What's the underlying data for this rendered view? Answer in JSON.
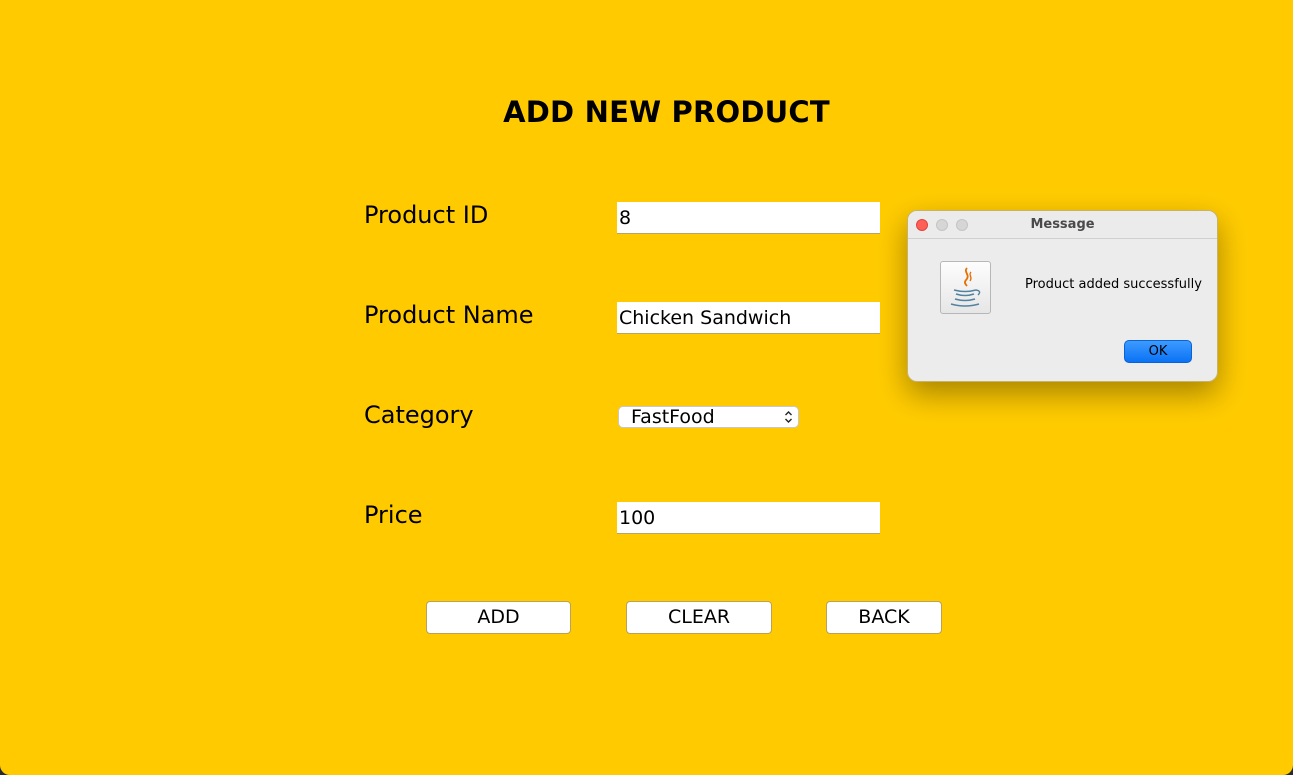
{
  "page": {
    "title": "ADD NEW PRODUCT",
    "background_color": "#ffcb00"
  },
  "form": {
    "product_id_label": "Product ID",
    "product_id_value": "8",
    "product_name_label": "Product Name",
    "product_name_value": "Chicken Sandwich",
    "category_label": "Category",
    "category_value": "FastFood",
    "price_label": "Price",
    "price_value": "100"
  },
  "buttons": {
    "add": "ADD",
    "clear": "CLEAR",
    "back": "BACK"
  },
  "dialog": {
    "title": "Message",
    "message": "Product added successfully",
    "ok": "OK",
    "icon": "java-icon",
    "ok_color": "#0a72f5"
  }
}
